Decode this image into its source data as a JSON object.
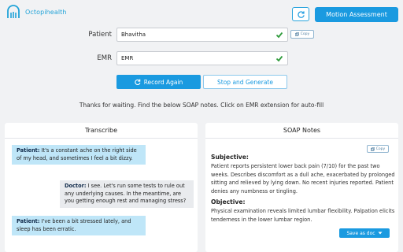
{
  "brand": {
    "name": "Octopihealth"
  },
  "header": {
    "motion_label": "Motion Assessment"
  },
  "form": {
    "patient_label": "Patient",
    "patient_value": "Bhavitha",
    "emr_label": "EMR",
    "emr_value": "EMR",
    "copy_label": "Copy"
  },
  "actions": {
    "record_label": "Record Again",
    "stop_label": "Stop and Generate"
  },
  "info_text": "Thanks for waiting. Find the below SOAP notes. Click on EMR extension for auto-fill",
  "transcribe": {
    "title": "Transcribe",
    "messages": [
      {
        "speaker": "Patient:",
        "text": "It's a constant ache on the right side of my head, and sometimes I feel a bit dizzy."
      },
      {
        "speaker": "Doctor:",
        "text": "I see. Let's run some tests to rule out any underlying causes. In the meantime, are you getting enough rest and managing stress?"
      },
      {
        "speaker": "Patient:",
        "text": "I've been a bit stressed lately, and sleep has been erratic."
      }
    ]
  },
  "soap": {
    "title": "SOAP Notes",
    "copy_label": "Copy",
    "subjective_heading": "Subjective:",
    "subjective_text": "Patient reports persistent lower back pain (7/10) for the past two weeks. Describes discomfort as a dull ache, exacerbated by prolonged sitting and relieved by lying down. No recent injuries reported. Patient denies any numbness or tingling.",
    "objective_heading": "Objective:",
    "objective_text": "Physical examination reveals limited lumbar flexibility. Palpation elicits tenderness in the lower lumbar region.",
    "save_label": "Save as doc"
  },
  "colors": {
    "accent": "#1a9ae0",
    "check": "#2e9a3a",
    "patient_bubble": "#bfe6f8",
    "doctor_bubble": "#e9ebee"
  },
  "icons": [
    "octopus-logo-icon",
    "refresh-icon",
    "check-icon",
    "copy-icon",
    "redo-icon",
    "caret-down-icon"
  ]
}
